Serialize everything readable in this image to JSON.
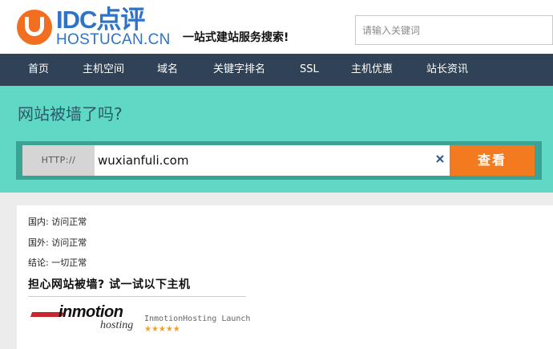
{
  "header": {
    "logo_text": "IDC点评",
    "logo_sub": "HOSTUCAN.CN",
    "slogan": "一站式建站服务搜索!",
    "search_placeholder": "请输入关键词"
  },
  "nav": {
    "items": [
      {
        "label": "首页"
      },
      {
        "label": "主机空间"
      },
      {
        "label": "域名"
      },
      {
        "label": "关键字排名"
      },
      {
        "label": "SSL"
      },
      {
        "label": "主机优惠"
      },
      {
        "label": "站长资讯"
      }
    ]
  },
  "hero": {
    "title": "网站被墙了吗?",
    "prefix": "HTTP://",
    "domain_value": "wuxianfuli.com",
    "clear_icon": "close-icon",
    "button_label": "查看"
  },
  "results": {
    "domestic": "国内: 访问正常",
    "foreign": "国外: 访问正常",
    "conclusion": "结论: 一切正常",
    "promo_title": "担心网站被墙? 试一试以下主机"
  },
  "host": {
    "brand_name": "inmotion",
    "brand_sub": "hosting",
    "link_text": "InmotionHosting Launch",
    "stars": "★★★★★",
    "rating": 5
  },
  "colors": {
    "nav_bg": "#2f4256",
    "hero_bg": "#5fd9c6",
    "button": "#f47a20",
    "logo_blue": "#2f73c5",
    "logo_orange": "#f26f21"
  }
}
